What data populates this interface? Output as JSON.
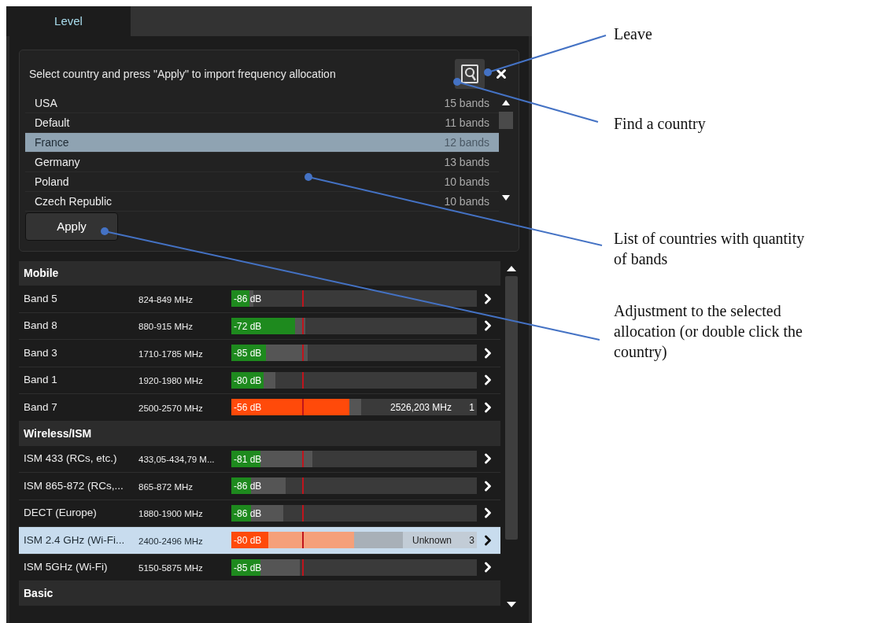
{
  "tab": {
    "label": "Level",
    "selected": true
  },
  "importer": {
    "prompt": "Select country and press \"Apply\" to import frequency allocation",
    "apply": "Apply",
    "countries": [
      {
        "name": "USA",
        "bands": "15 bands",
        "selected": false
      },
      {
        "name": "Default",
        "bands": "11 bands",
        "selected": false
      },
      {
        "name": "France",
        "bands": "12 bands",
        "selected": true
      },
      {
        "name": "Germany",
        "bands": "13 bands",
        "selected": false
      },
      {
        "name": "Poland",
        "bands": "10 bands",
        "selected": false
      },
      {
        "name": "Czech Republic",
        "bands": "10 bands",
        "selected": false
      }
    ]
  },
  "groups": [
    {
      "name": "Mobile",
      "bands": [
        {
          "name": "Band 5",
          "range": "824-849 MHz",
          "reading": "-86 dB",
          "alert": false,
          "selected": false,
          "level": 0.075,
          "hold": {
            "level": 0.09
          },
          "threshold": {
            "level": 0.29
          }
        },
        {
          "name": "Band 8",
          "range": "880-915 MHz",
          "reading": "-72 dB",
          "alert": false,
          "selected": false,
          "level": 0.26,
          "hold": {
            "level": 0.3
          },
          "threshold": {
            "level": 0.29
          }
        },
        {
          "name": "Band 3",
          "range": "1710-1785 MHz",
          "reading": "-85 dB",
          "alert": false,
          "selected": false,
          "level": 0.14,
          "hold": {
            "level": 0.31
          },
          "threshold": {
            "level": 0.29
          }
        },
        {
          "name": "Band 1",
          "range": "1920-1980 MHz",
          "reading": "-80 dB",
          "alert": false,
          "selected": false,
          "level": 0.13,
          "hold": {
            "level": 0.18
          },
          "threshold": {
            "level": 0.29
          }
        },
        {
          "name": "Band 7",
          "range": "2500-2570 MHz",
          "reading": "-56 dB",
          "alert": true,
          "selected": false,
          "level": 0.48,
          "hold": {
            "level": 0.53
          },
          "threshold": {
            "level": 0.29
          },
          "detail": "2526,203 MHz",
          "count": "1"
        }
      ]
    },
    {
      "name": "Wireless/ISM",
      "bands": [
        {
          "name": "ISM 433 (RCs, etc.)",
          "range": "433,05-434,79 M...",
          "reading": "-81 dB",
          "alert": false,
          "selected": false,
          "level": 0.12,
          "hold": {
            "level": 0.33
          },
          "threshold": {
            "level": 0.29
          }
        },
        {
          "name": "ISM 865-872 (RCs,...",
          "range": "865-872 MHz",
          "reading": "-86 dB",
          "alert": false,
          "selected": false,
          "level": 0.08,
          "hold": {
            "level": 0.22
          },
          "threshold": {
            "level": 0.29
          }
        },
        {
          "name": "DECT (Europe)",
          "range": "1880-1900 MHz",
          "reading": "-86 dB",
          "alert": false,
          "selected": false,
          "level": 0.08,
          "hold": {
            "level": 0.21
          },
          "threshold": {
            "level": 0.29
          }
        },
        {
          "name": "ISM 2.4 GHz (Wi-Fi...",
          "range": "2400-2496 MHz",
          "reading": "-80 dB",
          "alert": true,
          "selected": true,
          "level": 0.15,
          "span": {
            "level": 0.5
          },
          "hold": {
            "level": 0.7
          },
          "threshold": {
            "level": 0.29
          },
          "detail": "Unknown",
          "count": "3"
        },
        {
          "name": "ISM 5GHz (Wi-Fi)",
          "range": "5150-5875 MHz",
          "reading": "-85 dB",
          "alert": false,
          "selected": false,
          "level": 0.12,
          "hold": {
            "level": 0.28
          },
          "threshold": {
            "level": 0.29
          }
        }
      ]
    },
    {
      "name": "Basic"
    }
  ],
  "notes": [
    {
      "text": "Leave"
    },
    {
      "text": "Find a country"
    },
    {
      "text": "List of countries with quantity of bands"
    },
    {
      "text": "Adjustment to the selected allocation (or double click the country)"
    }
  ]
}
